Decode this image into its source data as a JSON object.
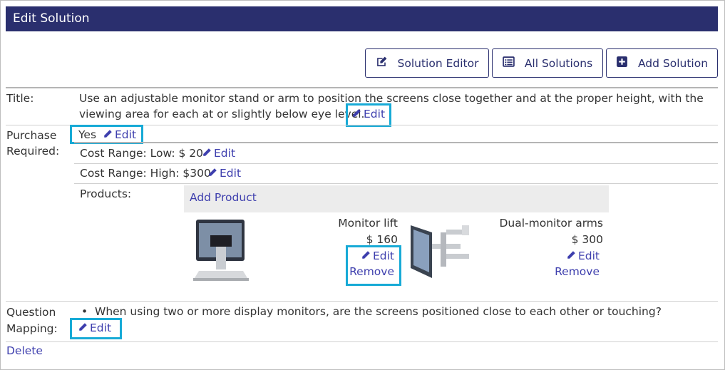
{
  "header": {
    "title": "Edit Solution"
  },
  "toolbar": {
    "solution_editor": "Solution Editor",
    "all_solutions": "All Solutions",
    "add_solution": "Add Solution"
  },
  "colors": {
    "header_bg": "#2a2f6e",
    "link": "#3e3fae",
    "highlight": "#17aad6"
  },
  "title_row": {
    "label": "Title:",
    "line1": "Use an adjustable monitor stand or arm to position the screens close together and at the proper height, with the",
    "line2": "viewing area for each at or slightly below eye level.",
    "edit": "Edit"
  },
  "purchase": {
    "label_line1": "Purchase",
    "label_line2": "Required:",
    "value": "Yes",
    "edit": "Edit",
    "cost_low": "Cost Range: Low: $ 20",
    "cost_low_edit": "Edit",
    "cost_high": "Cost Range: High: $300",
    "cost_high_edit": "Edit",
    "products_label": "Products:",
    "add_product": "Add Product"
  },
  "products": [
    {
      "name": "Monitor lift",
      "price": "$ 160",
      "edit": "Edit",
      "remove": "Remove",
      "icon": "monitor-lift-image"
    },
    {
      "name": "Dual-monitor arms",
      "price": "$ 300",
      "edit": "Edit",
      "remove": "Remove",
      "icon": "dual-monitor-arms-image"
    }
  ],
  "question": {
    "label_line1": "Question",
    "label_line2": "Mapping:",
    "bullet": "When using two or more display monitors, are the screens positioned close to each other or touching?",
    "edit": "Edit"
  },
  "footer": {
    "delete": "Delete"
  }
}
